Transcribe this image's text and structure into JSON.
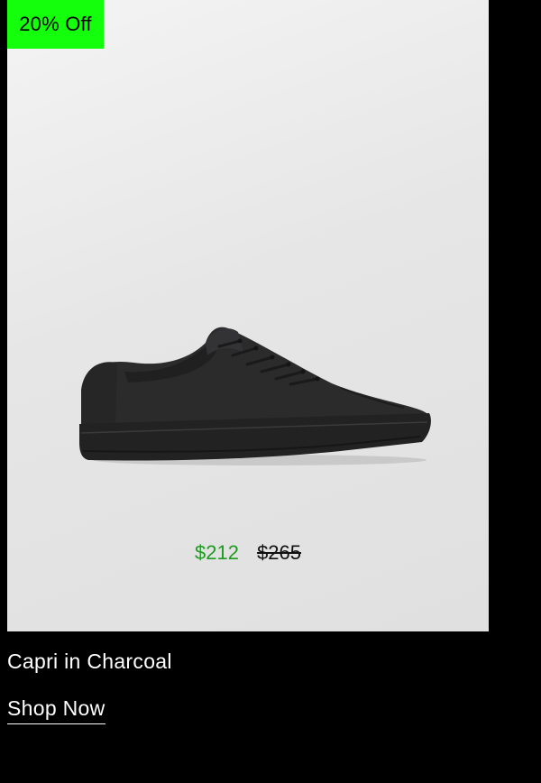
{
  "product": {
    "badge": "20% Off",
    "image_icon": "sneaker-image",
    "price_sale": "$212",
    "price_original": "$265",
    "name": "Capri in Charcoal",
    "cta": "Shop Now"
  },
  "colors": {
    "badge_bg": "#13ff0c",
    "sale_price": "#1f9a22",
    "page_bg": "#000000",
    "card_bg": "#e6e6e6"
  }
}
